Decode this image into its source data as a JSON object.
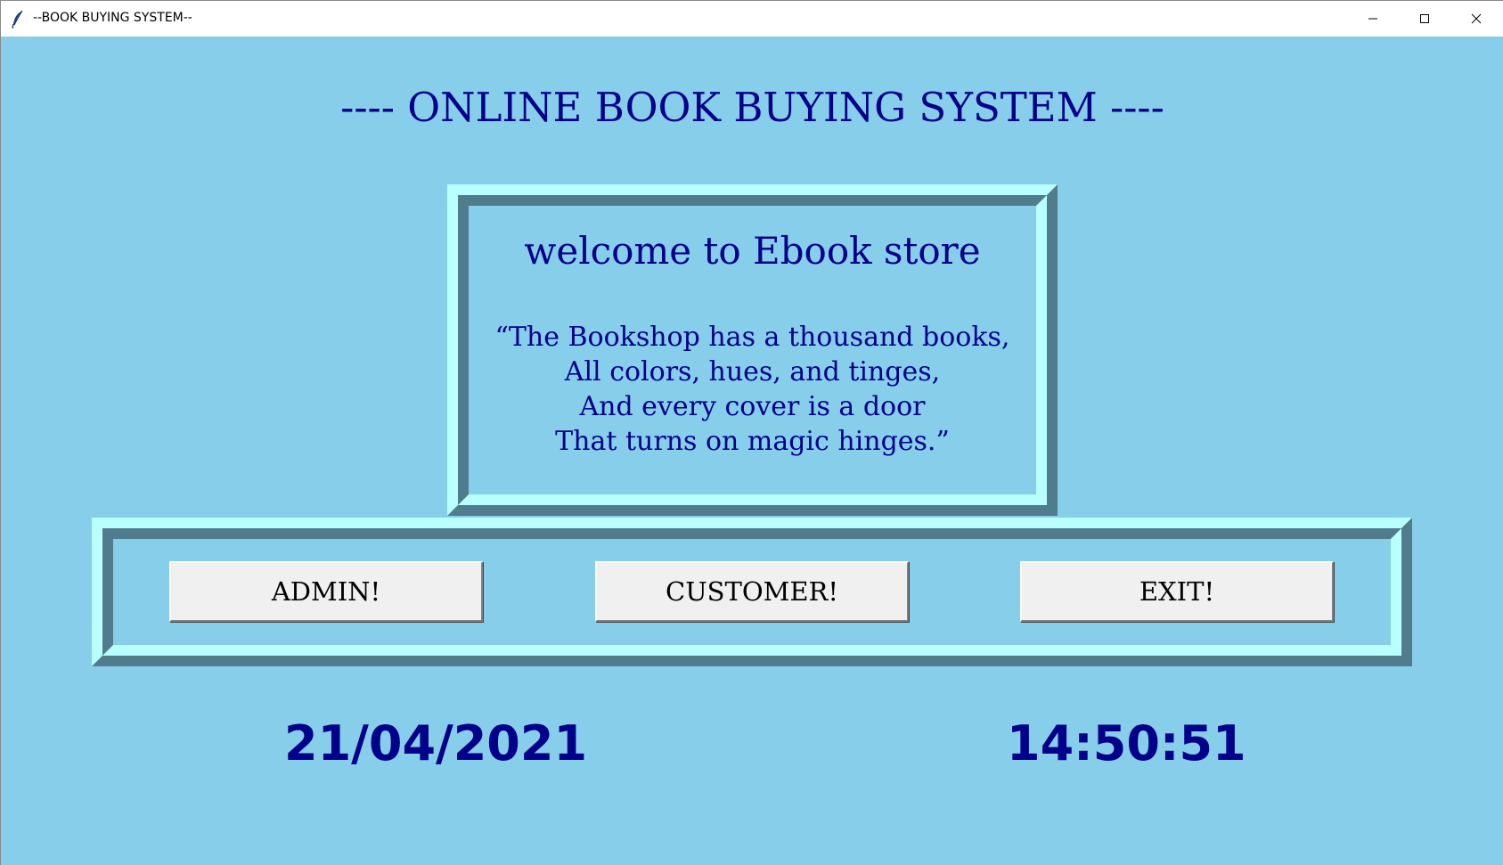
{
  "window": {
    "title": "--BOOK BUYING SYSTEM--",
    "icon": "feather-icon",
    "controls": [
      "minimize-icon",
      "maximize-icon",
      "close-icon"
    ]
  },
  "main": {
    "heading": "---- ONLINE BOOK BUYING SYSTEM ----",
    "welcome": {
      "title": "welcome to Ebook store",
      "quote_lines": [
        "“The Bookshop has a thousand books,",
        "All colors, hues, and tinges,",
        "And every cover is a door",
        "That turns on magic hinges.”"
      ]
    },
    "buttons": {
      "admin": "ADMIN!",
      "customer": "CUSTOMER!",
      "exit": "EXIT!"
    },
    "date": "21/04/2021",
    "time": "14:50:51"
  },
  "colors": {
    "background": "#87ceeb",
    "text": "#00008b",
    "frame_light": "#b9ffff",
    "frame_dark": "#517c8d",
    "button_face": "#f0f0f0"
  }
}
